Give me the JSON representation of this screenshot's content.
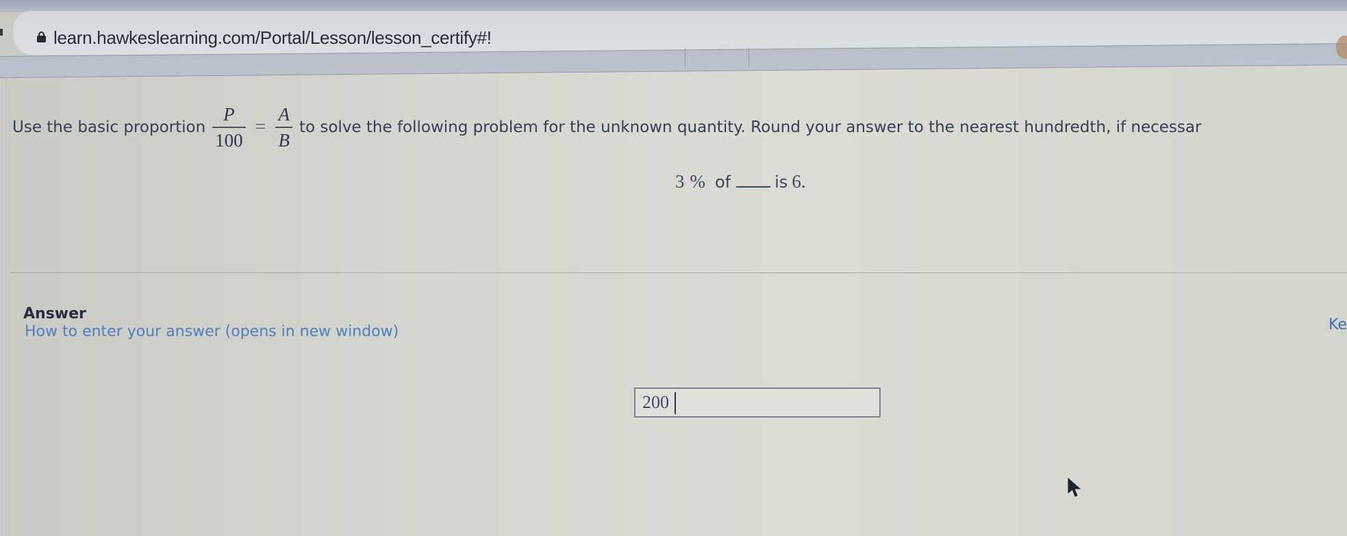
{
  "browser": {
    "url": "learn.hawkeslearning.com/Portal/Lesson/lesson_certify#!",
    "secure_icon": "lock-icon"
  },
  "question": {
    "prefix": "Use the basic proportion",
    "fraction_left": {
      "numerator": "P",
      "denominator": "100"
    },
    "equals": "=",
    "fraction_right": {
      "numerator": "A",
      "denominator": "B"
    },
    "suffix": "to solve the following problem for the unknown quantity. Round your answer to the nearest hundredth, if necessar",
    "problem": {
      "percent_value": "3",
      "percent_sign": "%",
      "of_word": "of",
      "is_word": "is",
      "result": "6."
    }
  },
  "answer": {
    "heading": "Answer",
    "help_link": "How to enter your answer (opens in new window)",
    "keypad_link": "Ke",
    "input_value": "200"
  },
  "colors": {
    "link": "#4f7fc0",
    "text": "#34405a",
    "background": "#d6d7d0"
  },
  "icons": {
    "cursor": "mouse-pointer-icon"
  }
}
